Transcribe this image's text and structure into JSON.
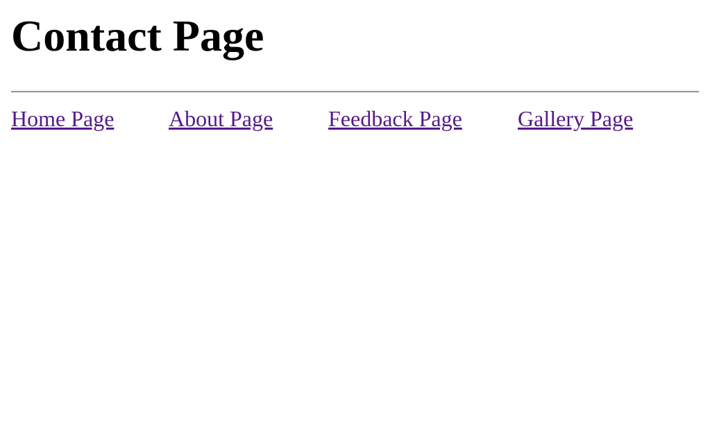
{
  "page": {
    "title": "Contact Page"
  },
  "nav": {
    "links": [
      {
        "label": "Home Page"
      },
      {
        "label": "About Page"
      },
      {
        "label": "Feedback Page"
      },
      {
        "label": "Gallery Page"
      }
    ]
  },
  "colors": {
    "link_visited": "#551a8b",
    "text": "#000000",
    "divider": "#9a9a9a",
    "background": "#ffffff"
  }
}
